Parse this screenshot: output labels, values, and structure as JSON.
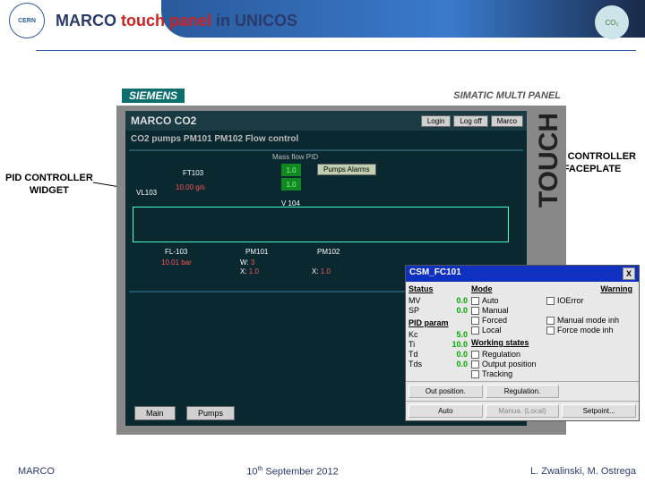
{
  "header": {
    "title_pre": "MARCO ",
    "title_red": "touch panel ",
    "title_post": "in UNICOS",
    "cern": "CERN",
    "co2": "CO₂"
  },
  "annotations": {
    "widget_l1": "PID CONTROLLER",
    "widget_l2": "WIDGET",
    "faceplate_l1": "PID CONTROLLER",
    "faceplate_l2": "FACEPLATE"
  },
  "panel": {
    "vendor": "SIEMENS",
    "model": "SIMATIC MULTI PANEL",
    "touch": "TOUCH",
    "app_title": "MARCO CO2",
    "subtitle": "CO2 pumps PM101 PM102 Flow control",
    "topbuttons": {
      "login": "Login",
      "logoff": "Log off",
      "user": "Marco"
    },
    "tags": {
      "ft103": "FT103",
      "vl103": "VL103",
      "flow_val": "10.00 g/s",
      "flow2": "10.01 bar",
      "pid_label": "Mass flow PID",
      "alarms": "Pumps Alarms",
      "v104": "V 104",
      "fl103": "FL-103",
      "pm101": "PM101",
      "pm102": "PM102",
      "w_pref": "W: ",
      "x1_pref": "X: ",
      "x2_pref": "X: ",
      "w": "3",
      "x1": "1.0",
      "x2": "1.0",
      "pid1": "1.0",
      "pid2": "1.0"
    },
    "nav": {
      "main": "Main",
      "pumps": "Pumps"
    }
  },
  "faceplate": {
    "title": "CSM_FC101",
    "close": "X",
    "headers": {
      "status": "Status",
      "mode": "Mode",
      "warning": "Warning",
      "pid": "PID param",
      "working": "Working states"
    },
    "status": {
      "mv_l": "MV",
      "mv_v": "0.0",
      "sp_l": "SP",
      "sp_v": "0.0"
    },
    "pid": {
      "kc_l": "Kc",
      "kc_v": "5.0",
      "ti_l": "Ti",
      "ti_v": "10.0",
      "td_l": "Td",
      "td_v": "0.0",
      "tds_l": "Tds",
      "tds_v": "0.0"
    },
    "mode": {
      "auto": "Auto",
      "manual": "Manual",
      "forced": "Forced",
      "local": "Local"
    },
    "warning": {
      "ioerr": "IOError",
      "mman": "Manual mode inh",
      "fman": "Force mode inh"
    },
    "working": {
      "reg": "Regulation",
      "out": "Output position",
      "trk": "Tracking"
    },
    "buttons": {
      "row1": {
        "out": "Out position.",
        "reg": "Regulation."
      },
      "row2": {
        "auto": "Auto",
        "manual": "Manua. (Local)",
        "setp": "Setpoint..."
      }
    }
  },
  "footer": {
    "left": "MARCO",
    "date": "10th September 2012",
    "date_day": "10",
    "date_sup": "th",
    "date_rest": " September 2012",
    "authors": "L. Zwalinski, M. Ostrega"
  }
}
